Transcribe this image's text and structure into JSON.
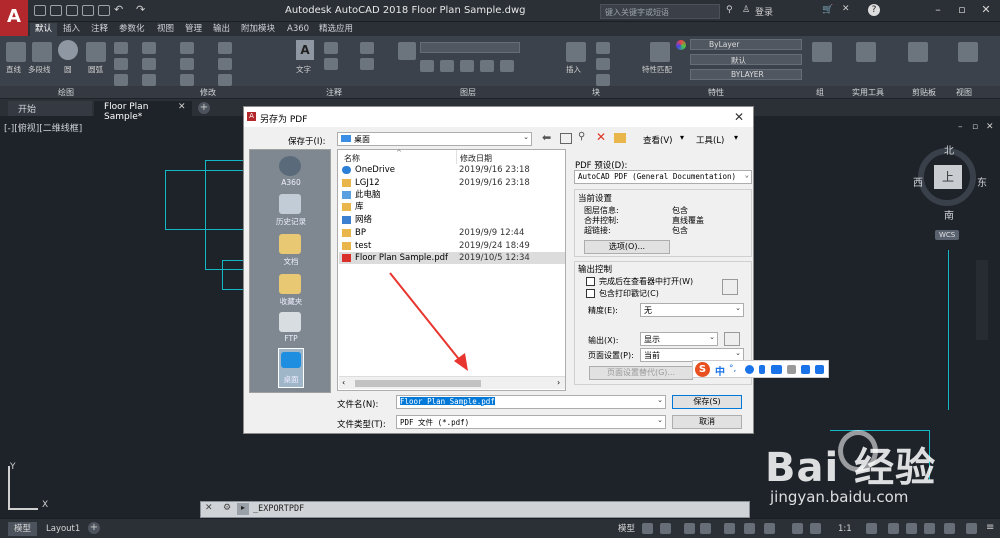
{
  "app": {
    "logo": "A",
    "title": "Autodesk AutoCAD 2018    Floor Plan Sample.dwg",
    "search_placeholder": "键入关键字或短语",
    "login": "登录",
    "help": "?"
  },
  "ribbon_tabs": [
    "默认",
    "插入",
    "注释",
    "参数化",
    "视图",
    "管理",
    "输出",
    "附加模块",
    "A360",
    "精选应用"
  ],
  "ribbon_groups": [
    "绘图",
    "修改",
    "注释",
    "图层",
    "块",
    "特性",
    "组",
    "实用工具",
    "剪贴板",
    "视图"
  ],
  "ribbon_labels": {
    "line": "直线",
    "polyline": "多段线",
    "circle": "圆",
    "arc": "圆弧",
    "text": "文字",
    "insert": "插入",
    "match": "特性匹配",
    "bylayer": "ByLayer",
    "bylayer2": "BYLAYER",
    "default": "默认"
  },
  "file_tabs": [
    "开始",
    "Floor Plan Sample*"
  ],
  "viewport_label": "[-][俯视][二维线框]",
  "compass": {
    "n": "北",
    "s": "南",
    "w": "西",
    "e": "东",
    "center": "上",
    "wcs": "WCS"
  },
  "command_line": "_EXPORTPDF",
  "layout_tabs": [
    "模型",
    "Layout1"
  ],
  "status": {
    "model": "模型",
    "scale": "1:1"
  },
  "dialog": {
    "title": "另存为 PDF",
    "save_in_label": "保存于(I):",
    "save_in_value": "桌面",
    "view_menu": "查看(V)",
    "tools_menu": "工具(L)",
    "places": [
      "A360",
      "历史记录",
      "文档",
      "收藏夹",
      "FTP",
      "桌面"
    ],
    "col_name": "名称",
    "col_date": "修改日期",
    "files": [
      {
        "name": "OneDrive",
        "date": "2019/9/16 23:18"
      },
      {
        "name": "LGJ12",
        "date": "2019/9/16 23:18"
      },
      {
        "name": "此电脑",
        "date": ""
      },
      {
        "name": "库",
        "date": ""
      },
      {
        "name": "网络",
        "date": ""
      },
      {
        "name": "BP",
        "date": "2019/9/9 12:44"
      },
      {
        "name": "test",
        "date": "2019/9/24 18:49"
      },
      {
        "name": "Floor Plan Sample.pdf",
        "date": "2019/10/5 12:34"
      }
    ],
    "pdf_preset_label": "PDF 预设(D):",
    "pdf_preset_value": "AutoCAD PDF (General Documentation)",
    "current_settings_title": "当前设置",
    "settings": [
      {
        "k": "图层信息:",
        "v": "包含"
      },
      {
        "k": "合并控制:",
        "v": "直线覆盖"
      },
      {
        "k": "超链接:",
        "v": "包含"
      }
    ],
    "options_button": "选项(O)...",
    "output_control_title": "输出控制",
    "open_after": "完成后在查看器中打开(W)",
    "include_stamp": "包含打印戳记(C)",
    "precision_label": "精度(E):",
    "precision_value": "无",
    "output_label": "输出(X):",
    "output_value": "显示",
    "page_setup_label": "页面设置(P):",
    "page_setup_value": "当前",
    "page_setup_override": "页面设置替代(G)...",
    "filename_label": "文件名(N):",
    "filename_value": "Floor Plan Sample.pdf",
    "filetype_label": "文件类型(T):",
    "filetype_value": "PDF 文件 (*.pdf)",
    "save_button": "保存(S)",
    "cancel_button": "取消"
  },
  "ime": {
    "zh": "中"
  },
  "watermark": {
    "brand": "Bai  经验",
    "url": "jingyan.baidu.com"
  },
  "colors": {
    "accent": "#b3282d",
    "cad_lines": "#14b7c7",
    "selection": "#0078d7",
    "arrow": "#e8352f"
  }
}
